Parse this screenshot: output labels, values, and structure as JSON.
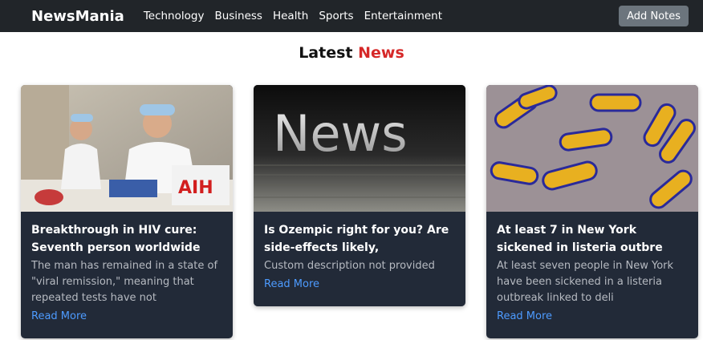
{
  "nav": {
    "brand": "NewsMania",
    "links": [
      "Technology",
      "Business",
      "Health",
      "Sports",
      "Entertainment"
    ],
    "add_notes_label": "Add Notes"
  },
  "heading": {
    "prefix": "Latest",
    "accent": "News"
  },
  "cards": [
    {
      "title": "Breakthrough in HIV cure: Seventh person worldwide",
      "description": "The man has remained in a state of \"viral remission,\" meaning that repeated tests have not",
      "read_more": "Read More",
      "image_text": "AIH"
    },
    {
      "title": "Is Ozempic right for you? Are side-effects likely,",
      "description": "Custom description not provided",
      "read_more": "Read More",
      "image_text": "News"
    },
    {
      "title": "At least 7 in New York sickened in listeria outbre",
      "description": "At least seven people in New York have been sickened in a listeria outbreak linked to deli",
      "read_more": "Read More"
    }
  ],
  "colors": {
    "navbar": "#212529",
    "accent": "#d62828",
    "card_bg": "#222a38",
    "link": "#4d9bff"
  }
}
